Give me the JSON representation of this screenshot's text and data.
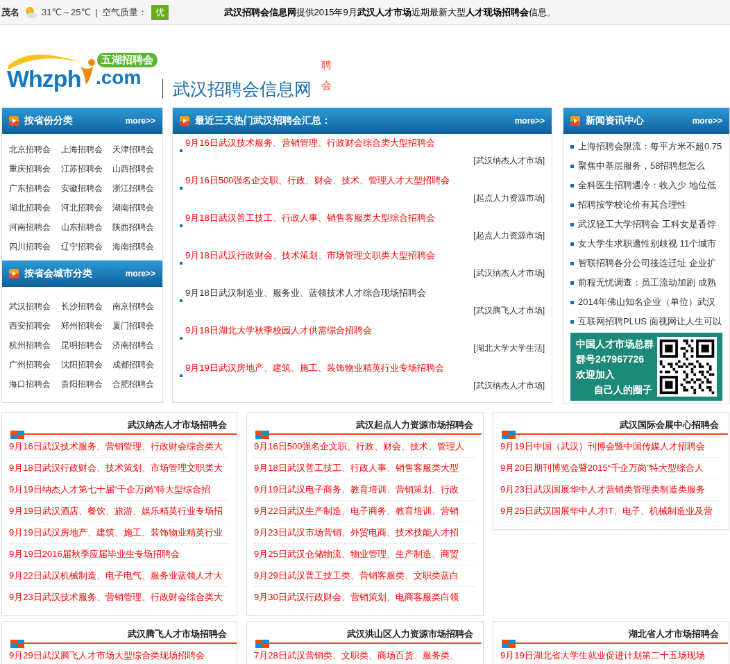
{
  "top_bar": {
    "city": "茂名",
    "temperature": "31℃～25℃",
    "separator": "|",
    "air_quality_label": "空气质量：",
    "air_quality": "优",
    "notice": "**武汉招聘会信息网**提供2015年9月**武汉人才市场**近期最新大型**人才现场招聘会**信息。"
  },
  "header": {
    "logo": {
      "wordmark": "Whzph",
      "domain": ".com",
      "badge": "五湖招聘会"
    },
    "site_name": "武汉招聘会信息网",
    "ticker": "聘会"
  },
  "province_panel": {
    "title": "按省份分类",
    "more": "more>>",
    "links": [
      "北京招聘会",
      "上海招聘会",
      "天津招聘会",
      "重庆招聘会",
      "江苏招聘会",
      "山西招聘会",
      "广东招聘会",
      "安徽招聘会",
      "浙江招聘会",
      "湖北招聘会",
      "河北招聘会",
      "湖南招聘会",
      "河南招聘会",
      "山东招聘会",
      "陕西招聘会",
      "四川招聘会",
      "辽宁招聘会",
      "海南招聘会"
    ]
  },
  "capital_panel": {
    "title": "按省会城市分类",
    "more": "more>>",
    "links": [
      "武汉招聘会",
      "长沙招聘会",
      "南京招聘会",
      "西安招聘会",
      "郑州招聘会",
      "厦门招聘会",
      "杭州招聘会",
      "昆明招聘会",
      "济南招聘会",
      "广州招聘会",
      "沈阳招聘会",
      "成都招聘会",
      "海口招聘会",
      "贵阳招聘会",
      "合肥招聘会"
    ]
  },
  "hot_panel": {
    "title": "最近三天热门武汉招聘会汇总：",
    "more": "more>>",
    "items": [
      {
        "title": "9月16日武汉技术服务、营销管理、行政财会综合类大型招聘会",
        "source": "[武汉纳杰人才市场]",
        "hot": true
      },
      {
        "title": "9月16日500强名企文职、行政、财会、技术、管理人才大型招聘会",
        "source": "[起点人力资源市场]",
        "hot": true
      },
      {
        "title": "9月18日武汉普工技工、行政人事、销售客服类大型综合招聘会",
        "source": "[起点人力资源市场]",
        "hot": true
      },
      {
        "title": "9月18日武汉行政财会、技术策划、市场管理文职类大型招聘会",
        "source": "[武汉纳杰人才市场]",
        "hot": true
      },
      {
        "title": "9月18日武汉制造业、服务业、蓝领技术人才综合现场招聘会",
        "source": "[武汉腾飞人才市场]",
        "hot": false
      },
      {
        "title": "9月18日湖北大学秋季校园人才供需综合招聘会",
        "source": "[湖北大学大学生活]",
        "hot": true
      },
      {
        "title": "9月19日武汉房地产、建筑、施工、装饰物业精英行业专场招聘会",
        "source": "[武汉纳杰人才市场]",
        "hot": true
      }
    ]
  },
  "news_panel": {
    "title": "新闻资讯中心",
    "more": "more>>",
    "items": [
      "上海招聘会限流：每平方米不超0.75",
      "聚焦中基层服务，58招聘想怎么",
      "全科医生招聘遇冷：收入少 地位低",
      "招聘按学校论价有其合理性",
      "武汉轻工大学招聘会 工科女是香饽",
      "女大学生求职遭性别歧视 11个城市",
      "智联招聘各分公司接连迁址 企业扩",
      "前程无忧调查：员工流动加剧 成熟",
      "2014年佛山知名企业（单位）武汉",
      "互联网招聘PLUS 面视网让人生可以"
    ],
    "banner": {
      "lines": [
        "中国人才市场总群",
        "群号247967726",
        "欢迎加入",
        "自己人的圈子"
      ]
    }
  },
  "market_boxes": [
    {
      "title": "武汉纳杰人才市场招聘会",
      "items": [
        "9月16日武汉技术服务、营销管理、行政财会综合类大",
        "9月18日武汉行政财会、技术策划、市场管理文职类大",
        "9月19日纳杰人才第七十届“千企万岗”特大型综合招",
        "9月19日武汉酒店、餐饮、旅游、娱乐精英行业专场招",
        "9月19日武汉房地产、建筑、施工、装饰物业精英行业",
        "9月19日2016届秋季应届毕业生专场招聘会",
        "9月22日武汉机械制造、电子电气、服务业蓝领人才大",
        "9月23日武汉技术服务、营销管理、行政财会综合类大"
      ]
    },
    {
      "title": "武汉起点人力资源市场招聘会",
      "items": [
        "9月16日500强名企文职、行政、财会、技术、管理人",
        "9月18日武汉普工技工、行政人事、销售客服类大型",
        "9月19日武汉电子商务、教育培训、营销策划、行政",
        "9月22日武汉生产制造、电子商务、教育培训、营销",
        "9月23日武汉市场营销、外贸电商、技术技能人才招",
        "9月25日武汉仓储物流、物业管理、生产制造、商贸",
        "9月29日武汉普工技工类、营销客服类、文职类蓝白",
        "9月30日武汉行政财会、营销策划、电商客服类白领"
      ]
    },
    {
      "title": "武汉国际会展中心招聘会",
      "items": [
        "9月19日中国（武汉）刊博会暨中国传媒人才招聘会",
        "9月20日期刊博览会暨2015“千企万岗”特大型综合人",
        "9月23日武汉国展华中人才营销类管理类制造类服务",
        "9月25日武汉国展华中人才IT、电子、机械制造业及营"
      ]
    },
    {
      "title": "武汉腾飞人才市场招聘会",
      "items": [
        "9月29日武汉腾飞人才市场大型综合类现场招聘会"
      ]
    },
    {
      "title": "武汉洪山区人力资源市场招聘会",
      "items": [
        "7月28日武汉营销类、文职类、商场百货、服务类、"
      ]
    },
    {
      "title": "湖北省人才市场招聘会",
      "items": [
        "9月19日湖北省大学生就业促进计划第二十五场现场"
      ]
    }
  ]
}
